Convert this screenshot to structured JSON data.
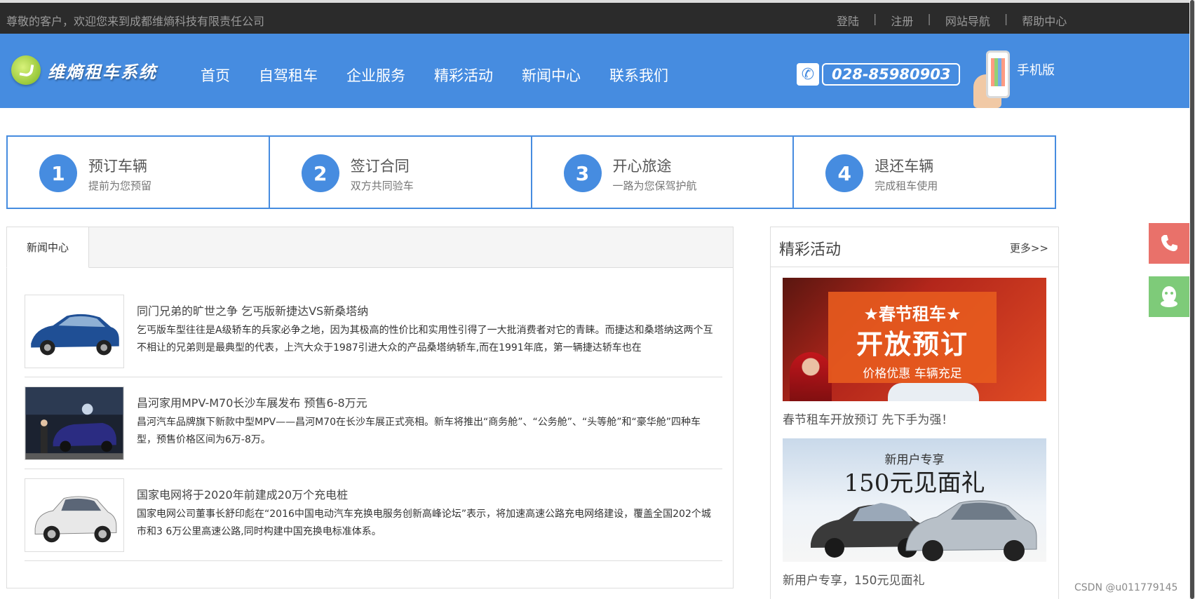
{
  "topbar": {
    "welcome": "尊敬的客户，欢迎您来到成都维熵科技有限责任公司",
    "links": [
      "登陆",
      "注册",
      "网站导航",
      "帮助中心"
    ],
    "separator": "|"
  },
  "header": {
    "logo_text": "维熵租车系统",
    "nav": [
      "首页",
      "自驾租车",
      "企业服务",
      "精彩活动",
      "新闻中心",
      "联系我们"
    ],
    "phone": "028-85980903",
    "mobile_label": "手机版"
  },
  "steps": [
    {
      "num": "1",
      "title": "预订车辆",
      "sub": "提前为您预留"
    },
    {
      "num": "2",
      "title": "签订合同",
      "sub": "双方共同验车"
    },
    {
      "num": "3",
      "title": "开心旅途",
      "sub": "一路为您保驾护航"
    },
    {
      "num": "4",
      "title": "退还车辆",
      "sub": "完成租车使用"
    }
  ],
  "news": {
    "tab": "新闻中心",
    "items": [
      {
        "title": "同门兄弟的旷世之争 乞丐版新捷达VS新桑塔纳",
        "desc": "乞丐版车型往往是A级轿车的兵家必争之地，因为其极高的性价比和实用性引得了一大批消费者对它的青睐。而捷达和桑塔纳这两个互不相让的兄弟则是最典型的代表，上汽大众于1987引进大众的产品桑塔纳轿车,而在1991年底，第一辆捷达轿车也在"
      },
      {
        "title": "昌河家用MPV-M70长沙车展发布 预售6-8万元",
        "desc": "昌河汽车品牌旗下新款中型MPV——昌河M70在长沙车展正式亮相。新车将推出“商务舱”、“公务舱”、“头等舱”和“豪华舱”四种车型，预售价格区间为6万-8万。"
      },
      {
        "title": "国家电网将于2020年前建成20万个充电桩",
        "desc": "国家电网公司董事长舒印彪在“2016中国电动汽车充换电服务创新高峰论坛”表示，将加速高速公路充电网络建设，覆盖全国202个城市和3 6万公里高速公路,同时构建中国充换电标准体系。"
      }
    ]
  },
  "activities": {
    "title": "精彩活动",
    "more": "更多>>",
    "cards": [
      {
        "caption": "春节租车开放预订 先下手为强！",
        "banner": {
          "line1": "★春节租车★",
          "line2": "开放预订",
          "line3": "价格优惠 车辆充足"
        }
      },
      {
        "caption": "新用户专享，150元见面礼",
        "banner": {
          "line1": "新用户专享",
          "line2": "150元见面礼"
        }
      }
    ]
  },
  "floating": {
    "call_icon": "phone-icon",
    "qq_icon": "qq-icon"
  },
  "watermark": "CSDN @u011779145",
  "colors": {
    "brand_blue": "#468ce0",
    "topbar": "#2b2b2b",
    "call": "#e9716a",
    "qq": "#7ecb79"
  }
}
